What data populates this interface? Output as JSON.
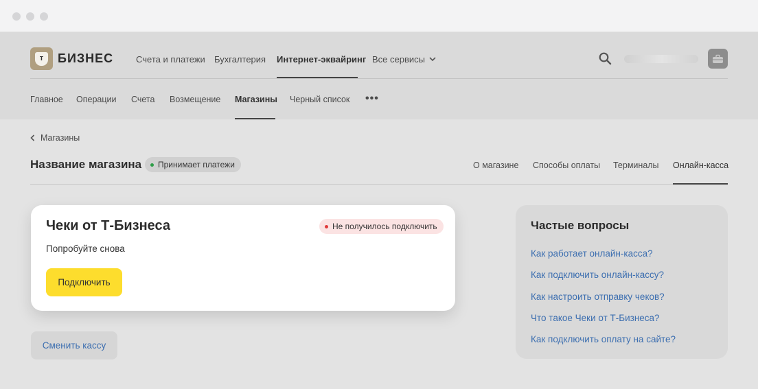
{
  "brand": {
    "logo_glyph": "т",
    "name": "БИЗНЕС",
    "badge_color": "#b09f80"
  },
  "topnav": {
    "items": [
      "Счета и платежи",
      "Бухгалтерия",
      "Интернет-эквайринг",
      "Все сервисы"
    ],
    "active": "Интернет-эквайринг"
  },
  "subnav": {
    "items": [
      "Главное",
      "Операции",
      "Счета",
      "Возмещение",
      "Магазины",
      "Черный список"
    ],
    "active": "Магазины",
    "more_label": "•••"
  },
  "breadcrumb": {
    "label": "Магазины"
  },
  "store": {
    "title": "Название магазина",
    "status": "Принимает платежи",
    "tabs": [
      "О магазине",
      "Способы оплаты",
      "Терминалы",
      "Онлайн-касса"
    ],
    "active_tab": "Онлайн-касса"
  },
  "card": {
    "title": "Чеки от Т-Бизнеса",
    "error_status": "Не получилось подключить",
    "subtitle": "Попробуйте снова",
    "connect_label": "Подключить"
  },
  "change_button": {
    "label": "Сменить кассу"
  },
  "faq": {
    "title": "Частые вопросы",
    "links": [
      "Как работает онлайн-касса?",
      "Как подключить онлайн-кассу?",
      "Как настроить отправку чеков?",
      "Что такое Чеки от Т-Бизнеса?",
      "Как подключить оплату на сайте?"
    ]
  },
  "colors": {
    "accent_yellow": "#fddd2d",
    "link_blue": "#3d6fb0",
    "success_green": "#2e9d48",
    "error_red": "#e03b3b"
  }
}
